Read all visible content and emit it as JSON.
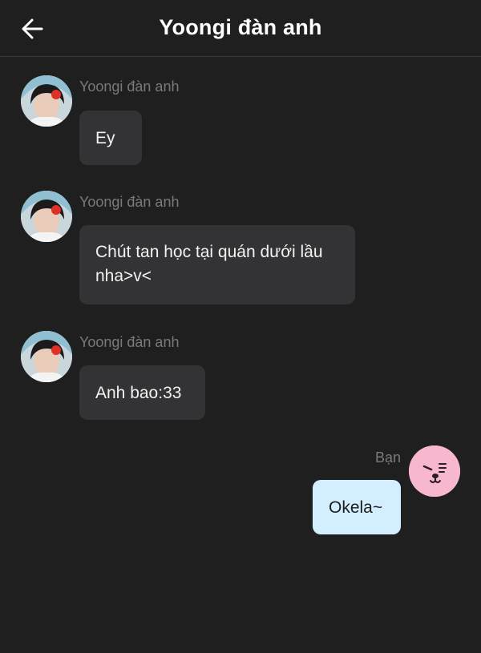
{
  "header": {
    "title": "Yoongi đàn anh",
    "back_icon": "arrow-left-icon"
  },
  "messages": [
    {
      "sender": "Yoongi đàn anh",
      "text": "Ey",
      "from": "other"
    },
    {
      "sender": "Yoongi đàn anh",
      "text_lines": [
        "Chút tan học tại quán dưới lầu",
        "nha>v<"
      ],
      "from": "other"
    },
    {
      "sender": "Yoongi đàn anh",
      "text": "Anh bao:33",
      "from": "other"
    },
    {
      "sender": "Bạn",
      "text": "Okela~",
      "from": "me"
    }
  ],
  "colors": {
    "background": "#1f1f20",
    "bubble_other": "#333335",
    "bubble_me": "#d3efff",
    "self_avatar": "#f7b7cf"
  }
}
